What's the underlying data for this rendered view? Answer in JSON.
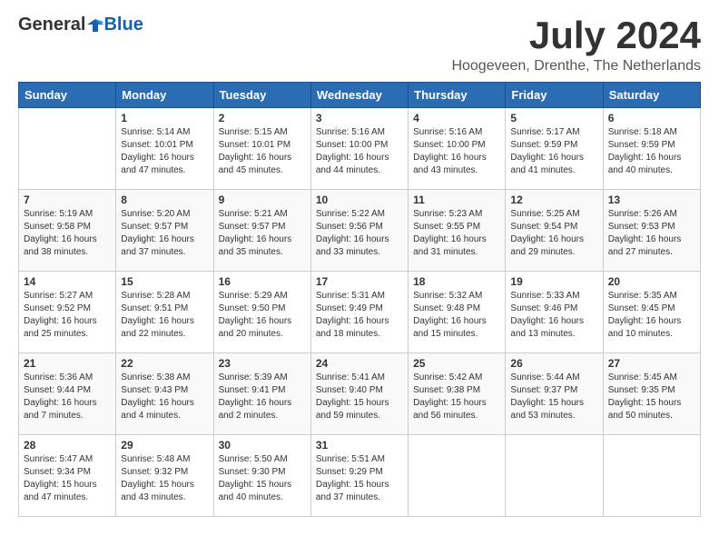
{
  "logo": {
    "general": "General",
    "blue": "Blue"
  },
  "title": "July 2024",
  "location": "Hoogeveen, Drenthe, The Netherlands",
  "days_of_week": [
    "Sunday",
    "Monday",
    "Tuesday",
    "Wednesday",
    "Thursday",
    "Friday",
    "Saturday"
  ],
  "weeks": [
    [
      {
        "day": "",
        "sunrise": "",
        "sunset": "",
        "daylight": ""
      },
      {
        "day": "1",
        "sunrise": "Sunrise: 5:14 AM",
        "sunset": "Sunset: 10:01 PM",
        "daylight": "Daylight: 16 hours and 47 minutes."
      },
      {
        "day": "2",
        "sunrise": "Sunrise: 5:15 AM",
        "sunset": "Sunset: 10:01 PM",
        "daylight": "Daylight: 16 hours and 45 minutes."
      },
      {
        "day": "3",
        "sunrise": "Sunrise: 5:16 AM",
        "sunset": "Sunset: 10:00 PM",
        "daylight": "Daylight: 16 hours and 44 minutes."
      },
      {
        "day": "4",
        "sunrise": "Sunrise: 5:16 AM",
        "sunset": "Sunset: 10:00 PM",
        "daylight": "Daylight: 16 hours and 43 minutes."
      },
      {
        "day": "5",
        "sunrise": "Sunrise: 5:17 AM",
        "sunset": "Sunset: 9:59 PM",
        "daylight": "Daylight: 16 hours and 41 minutes."
      },
      {
        "day": "6",
        "sunrise": "Sunrise: 5:18 AM",
        "sunset": "Sunset: 9:59 PM",
        "daylight": "Daylight: 16 hours and 40 minutes."
      }
    ],
    [
      {
        "day": "7",
        "sunrise": "Sunrise: 5:19 AM",
        "sunset": "Sunset: 9:58 PM",
        "daylight": "Daylight: 16 hours and 38 minutes."
      },
      {
        "day": "8",
        "sunrise": "Sunrise: 5:20 AM",
        "sunset": "Sunset: 9:57 PM",
        "daylight": "Daylight: 16 hours and 37 minutes."
      },
      {
        "day": "9",
        "sunrise": "Sunrise: 5:21 AM",
        "sunset": "Sunset: 9:57 PM",
        "daylight": "Daylight: 16 hours and 35 minutes."
      },
      {
        "day": "10",
        "sunrise": "Sunrise: 5:22 AM",
        "sunset": "Sunset: 9:56 PM",
        "daylight": "Daylight: 16 hours and 33 minutes."
      },
      {
        "day": "11",
        "sunrise": "Sunrise: 5:23 AM",
        "sunset": "Sunset: 9:55 PM",
        "daylight": "Daylight: 16 hours and 31 minutes."
      },
      {
        "day": "12",
        "sunrise": "Sunrise: 5:25 AM",
        "sunset": "Sunset: 9:54 PM",
        "daylight": "Daylight: 16 hours and 29 minutes."
      },
      {
        "day": "13",
        "sunrise": "Sunrise: 5:26 AM",
        "sunset": "Sunset: 9:53 PM",
        "daylight": "Daylight: 16 hours and 27 minutes."
      }
    ],
    [
      {
        "day": "14",
        "sunrise": "Sunrise: 5:27 AM",
        "sunset": "Sunset: 9:52 PM",
        "daylight": "Daylight: 16 hours and 25 minutes."
      },
      {
        "day": "15",
        "sunrise": "Sunrise: 5:28 AM",
        "sunset": "Sunset: 9:51 PM",
        "daylight": "Daylight: 16 hours and 22 minutes."
      },
      {
        "day": "16",
        "sunrise": "Sunrise: 5:29 AM",
        "sunset": "Sunset: 9:50 PM",
        "daylight": "Daylight: 16 hours and 20 minutes."
      },
      {
        "day": "17",
        "sunrise": "Sunrise: 5:31 AM",
        "sunset": "Sunset: 9:49 PM",
        "daylight": "Daylight: 16 hours and 18 minutes."
      },
      {
        "day": "18",
        "sunrise": "Sunrise: 5:32 AM",
        "sunset": "Sunset: 9:48 PM",
        "daylight": "Daylight: 16 hours and 15 minutes."
      },
      {
        "day": "19",
        "sunrise": "Sunrise: 5:33 AM",
        "sunset": "Sunset: 9:46 PM",
        "daylight": "Daylight: 16 hours and 13 minutes."
      },
      {
        "day": "20",
        "sunrise": "Sunrise: 5:35 AM",
        "sunset": "Sunset: 9:45 PM",
        "daylight": "Daylight: 16 hours and 10 minutes."
      }
    ],
    [
      {
        "day": "21",
        "sunrise": "Sunrise: 5:36 AM",
        "sunset": "Sunset: 9:44 PM",
        "daylight": "Daylight: 16 hours and 7 minutes."
      },
      {
        "day": "22",
        "sunrise": "Sunrise: 5:38 AM",
        "sunset": "Sunset: 9:43 PM",
        "daylight": "Daylight: 16 hours and 4 minutes."
      },
      {
        "day": "23",
        "sunrise": "Sunrise: 5:39 AM",
        "sunset": "Sunset: 9:41 PM",
        "daylight": "Daylight: 16 hours and 2 minutes."
      },
      {
        "day": "24",
        "sunrise": "Sunrise: 5:41 AM",
        "sunset": "Sunset: 9:40 PM",
        "daylight": "Daylight: 15 hours and 59 minutes."
      },
      {
        "day": "25",
        "sunrise": "Sunrise: 5:42 AM",
        "sunset": "Sunset: 9:38 PM",
        "daylight": "Daylight: 15 hours and 56 minutes."
      },
      {
        "day": "26",
        "sunrise": "Sunrise: 5:44 AM",
        "sunset": "Sunset: 9:37 PM",
        "daylight": "Daylight: 15 hours and 53 minutes."
      },
      {
        "day": "27",
        "sunrise": "Sunrise: 5:45 AM",
        "sunset": "Sunset: 9:35 PM",
        "daylight": "Daylight: 15 hours and 50 minutes."
      }
    ],
    [
      {
        "day": "28",
        "sunrise": "Sunrise: 5:47 AM",
        "sunset": "Sunset: 9:34 PM",
        "daylight": "Daylight: 15 hours and 47 minutes."
      },
      {
        "day": "29",
        "sunrise": "Sunrise: 5:48 AM",
        "sunset": "Sunset: 9:32 PM",
        "daylight": "Daylight: 15 hours and 43 minutes."
      },
      {
        "day": "30",
        "sunrise": "Sunrise: 5:50 AM",
        "sunset": "Sunset: 9:30 PM",
        "daylight": "Daylight: 15 hours and 40 minutes."
      },
      {
        "day": "31",
        "sunrise": "Sunrise: 5:51 AM",
        "sunset": "Sunset: 9:29 PM",
        "daylight": "Daylight: 15 hours and 37 minutes."
      },
      {
        "day": "",
        "sunrise": "",
        "sunset": "",
        "daylight": ""
      },
      {
        "day": "",
        "sunrise": "",
        "sunset": "",
        "daylight": ""
      },
      {
        "day": "",
        "sunrise": "",
        "sunset": "",
        "daylight": ""
      }
    ]
  ]
}
